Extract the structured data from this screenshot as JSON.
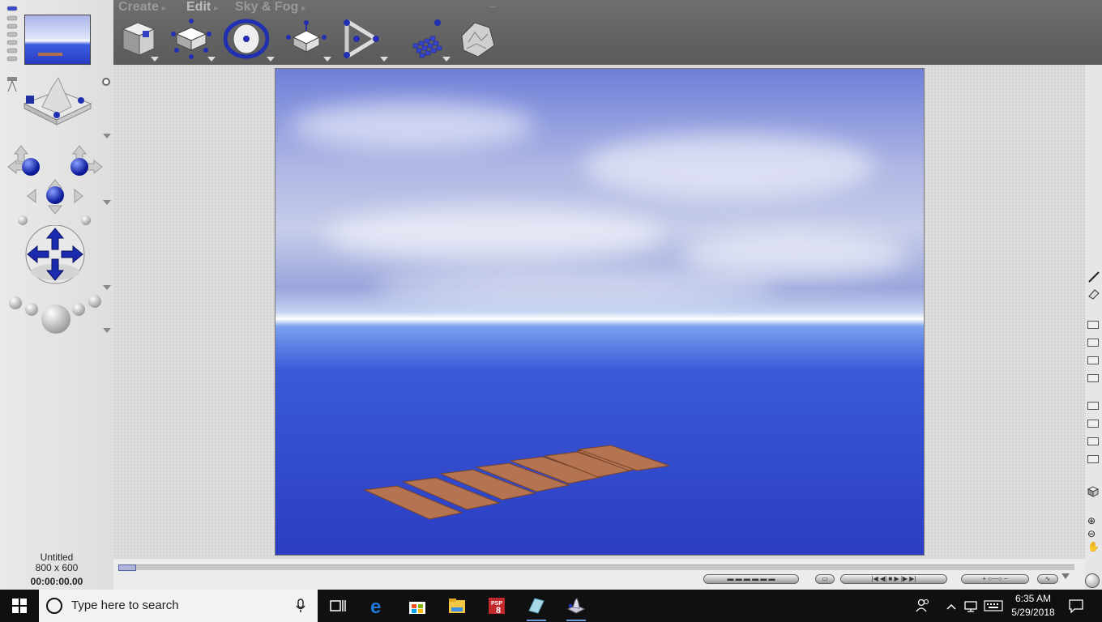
{
  "menu": {
    "create": "Create",
    "edit": "Edit",
    "sky_fog": "Sky & Fog"
  },
  "document": {
    "name": "Untitled",
    "size": "800 x 600",
    "time": "00:00:00.00"
  },
  "taskbar": {
    "search_placeholder": "Type here to search",
    "time": "6:35 AM",
    "date": "5/29/2018"
  },
  "colors": {
    "viewport_sky": "#9aa6dc",
    "viewport_sea": "#2b3dc2",
    "accent_blue": "#1a2bb0",
    "planks": "#b07050"
  },
  "icons": {
    "toolbar": [
      "terrain-cube-icon",
      "create-object-icon",
      "orbit-camera-icon",
      "move-object-icon",
      "animation-path-icon",
      "pixel-cubes-icon",
      "rock-material-icon"
    ],
    "taskbar": [
      "windows-start-icon",
      "cortana-search-icon",
      "microphone-icon",
      "task-view-icon",
      "edge-icon",
      "store-icon",
      "file-explorer-icon",
      "paintshop-pro-icon",
      "glass-app-icon",
      "bryce-app-icon",
      "people-icon",
      "chevron-up-icon",
      "network-icon",
      "keyboard-icon",
      "notifications-icon"
    ]
  }
}
